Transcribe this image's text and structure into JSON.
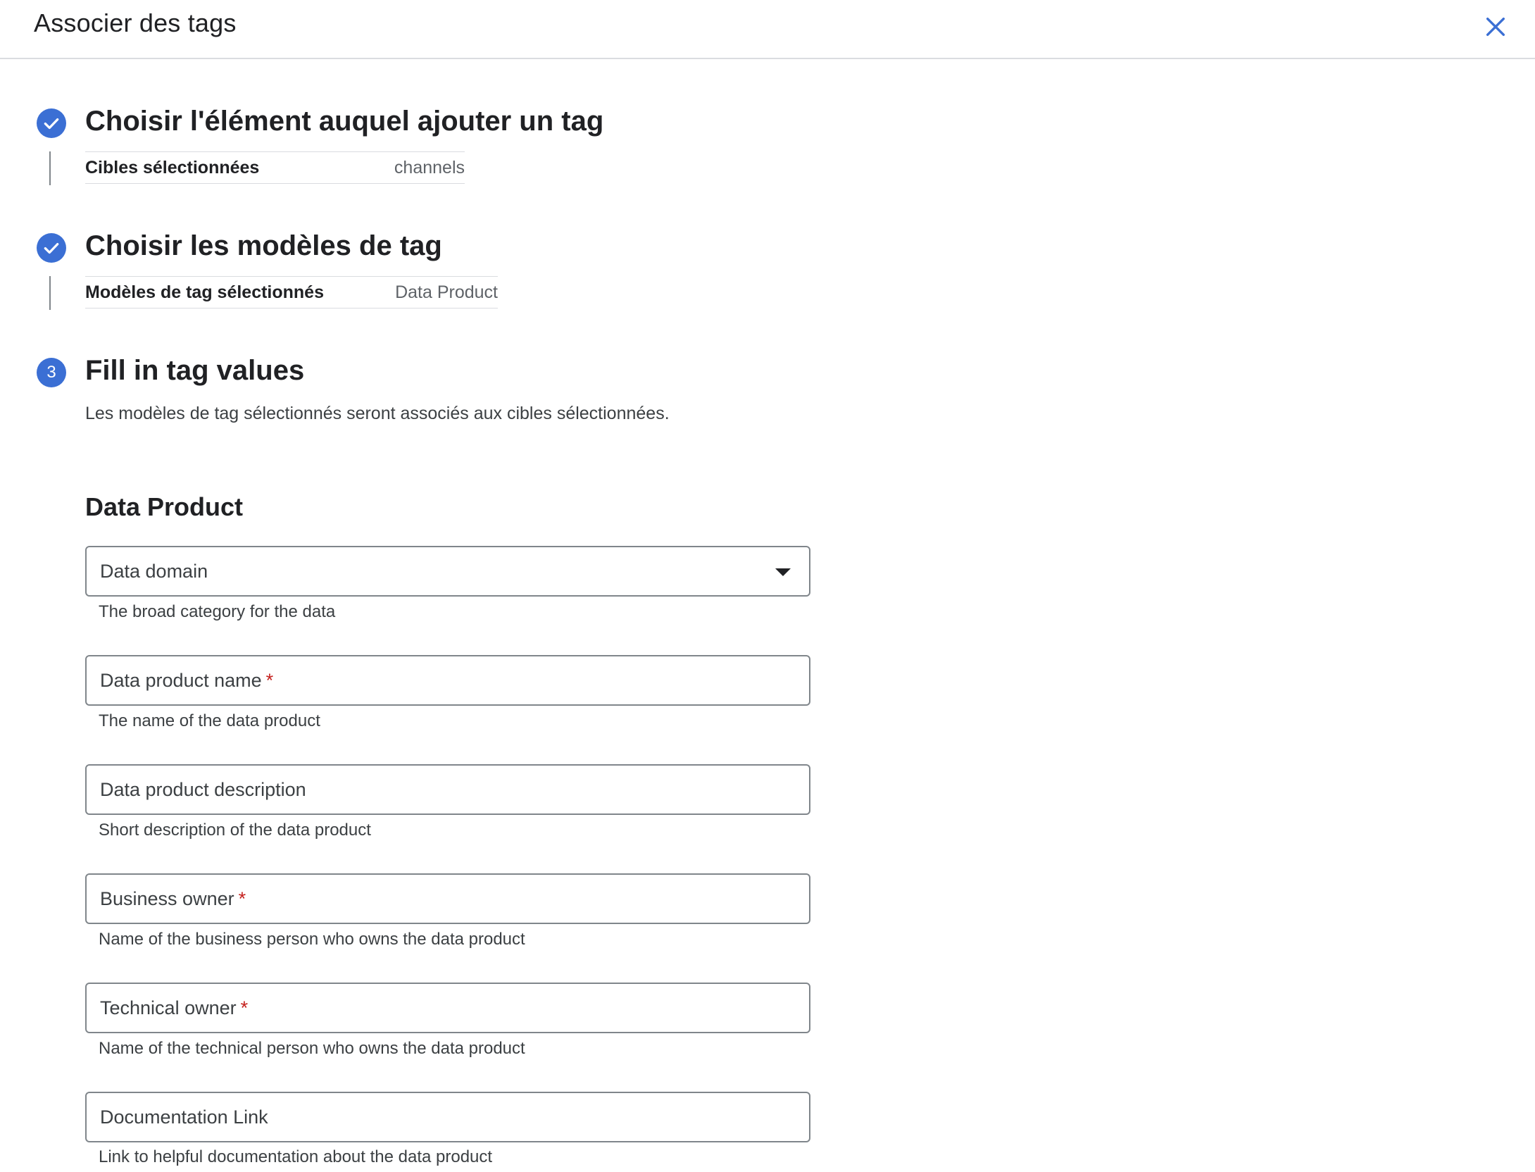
{
  "header": {
    "title": "Associer des tags",
    "close_icon": "close-icon"
  },
  "steps": [
    {
      "state": "done",
      "title": "Choisir l'élément auquel ajouter un tag",
      "summary_label": "Cibles sélectionnées",
      "summary_value": "channels"
    },
    {
      "state": "done",
      "title": "Choisir les modèles de tag",
      "summary_label": "Modèles de tag sélectionnés",
      "summary_value": "Data Product"
    },
    {
      "state": "active",
      "number": "3",
      "title": "Fill in tag values",
      "description": "Les modèles de tag sélectionnés seront associés aux cibles sélectionnées."
    }
  ],
  "form": {
    "section_title": "Data Product",
    "fields": [
      {
        "label": "Data domain",
        "required": "",
        "hint": "The broad category for the data",
        "type": "select"
      },
      {
        "label": "Data product name",
        "required": "*",
        "hint": "The name of the data product",
        "type": "text"
      },
      {
        "label": "Data product description",
        "required": "",
        "hint": "Short description of the data product",
        "type": "text"
      },
      {
        "label": "Business owner",
        "required": "*",
        "hint": "Name of the business person who owns the data product",
        "type": "text"
      },
      {
        "label": "Technical owner",
        "required": "*",
        "hint": "Name of the technical person who owns the data product",
        "type": "text"
      },
      {
        "label": "Documentation Link",
        "required": "",
        "hint": "Link to helpful documentation about the data product",
        "type": "text"
      }
    ]
  },
  "colors": {
    "accent": "#3b6fd4",
    "required": "#c5221f",
    "border": "#80868b"
  }
}
